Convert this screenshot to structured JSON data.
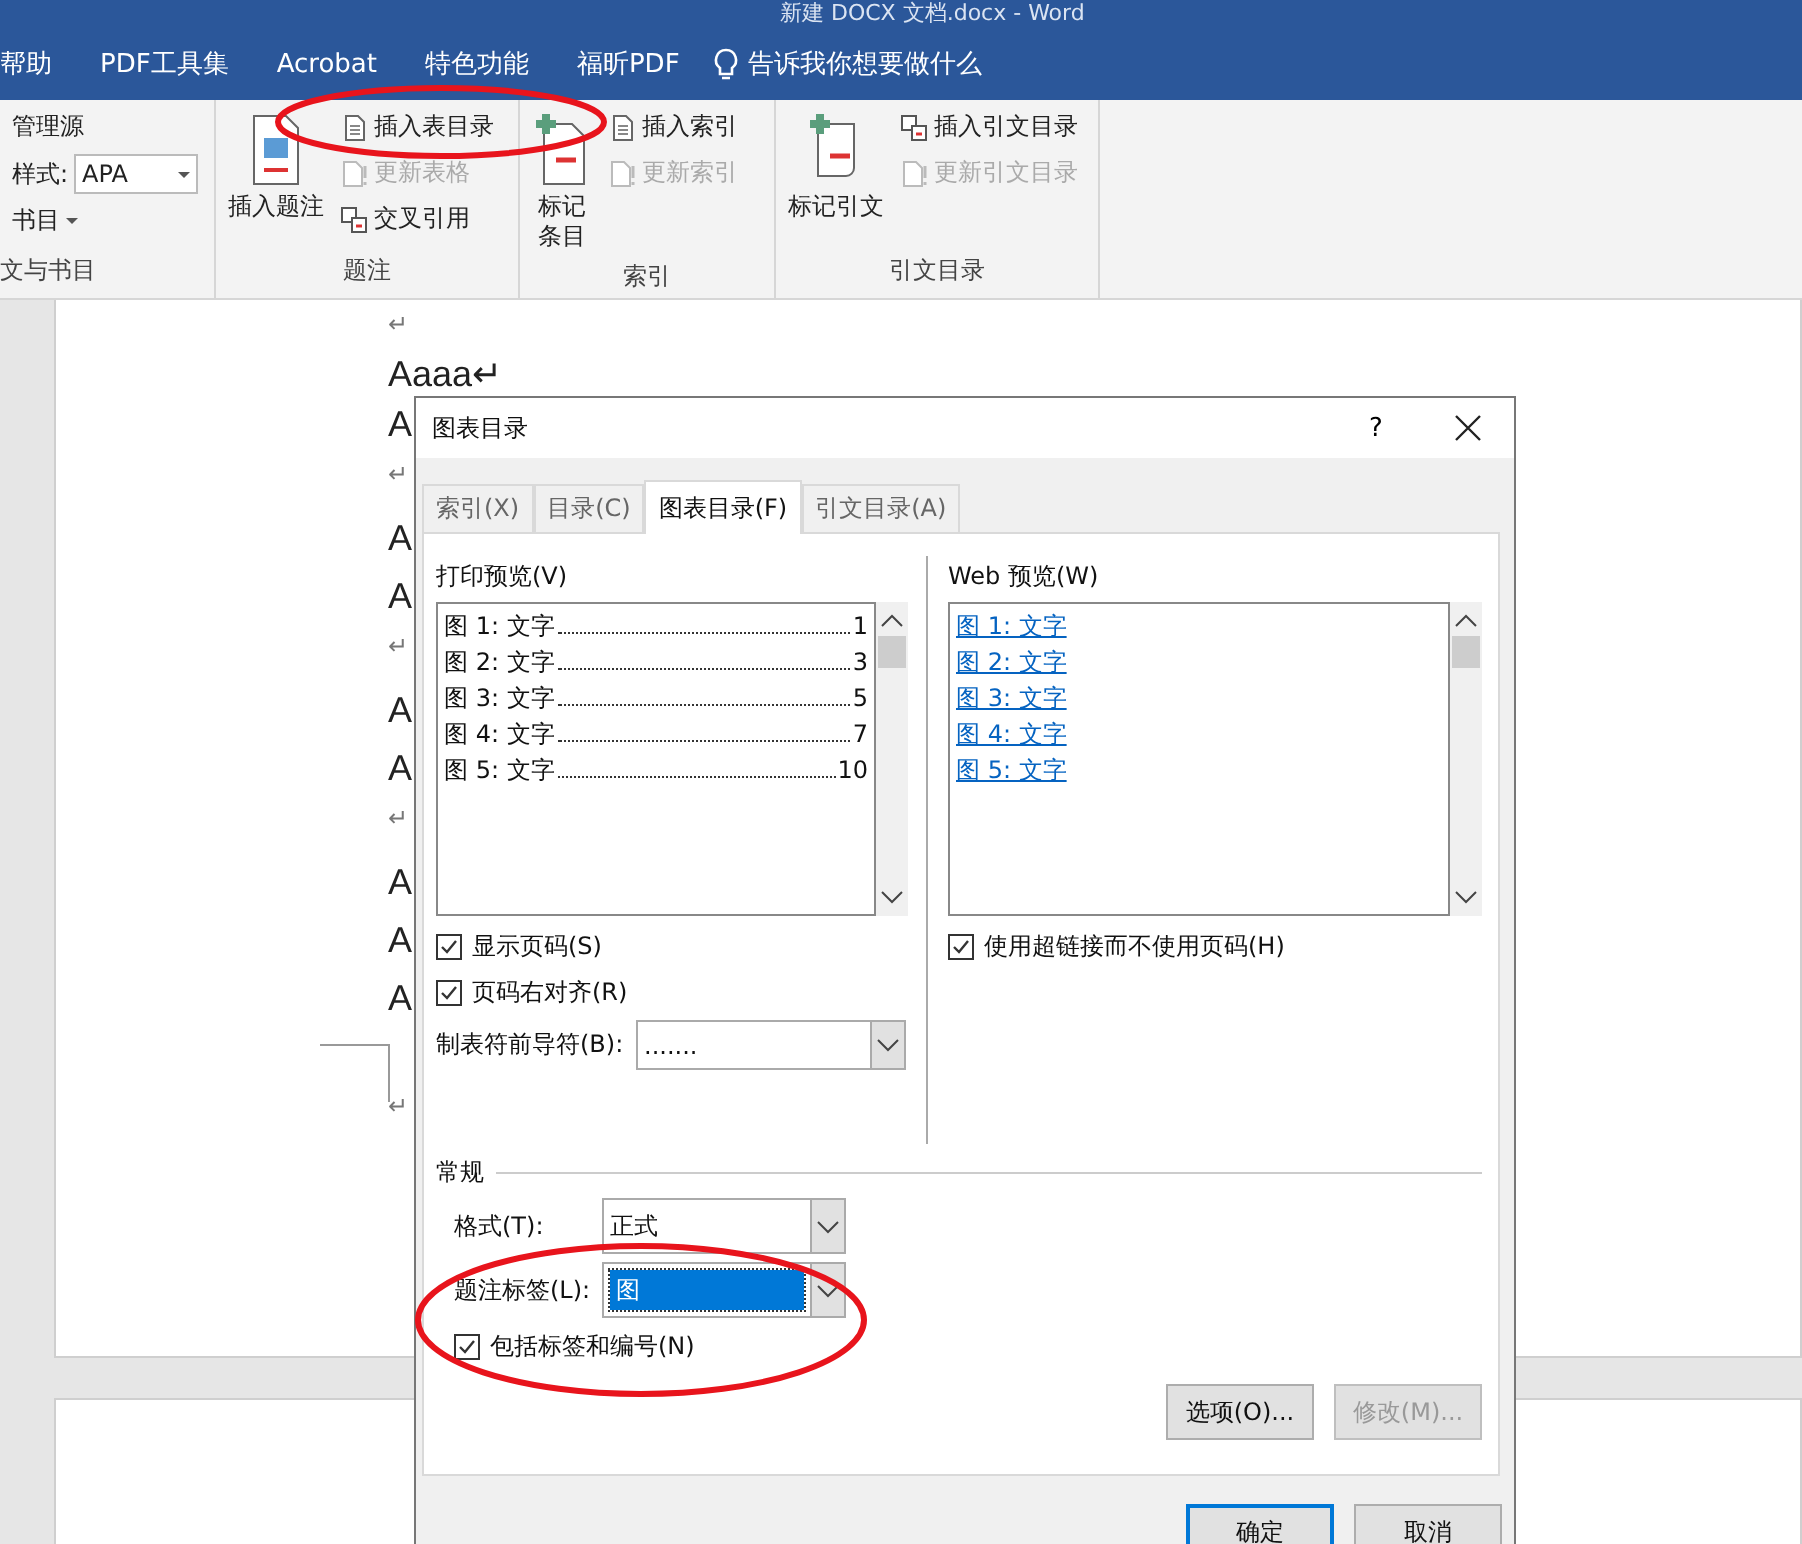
{
  "window": {
    "title": "新建 DOCX 文档.docx - Word"
  },
  "menu": [
    {
      "label": "帮助"
    },
    {
      "label": "PDF工具集"
    },
    {
      "label": "Acrobat"
    },
    {
      "label": "特色功能"
    },
    {
      "label": "福昕PDF"
    }
  ],
  "tell_me": "告诉我你想要做什么",
  "ribbon": {
    "groups": [
      {
        "label": "文与书目",
        "small": [
          {
            "kind": "button",
            "label": "管理源",
            "disabled": false
          },
          {
            "kind": "combo",
            "label": "样式:",
            "value": "APA"
          },
          {
            "kind": "dropdown",
            "label": "书目",
            "disabled": false
          }
        ]
      },
      {
        "label": "题注",
        "large": [
          {
            "label": "插入题注",
            "narrow": false
          }
        ],
        "small": [
          {
            "kind": "button",
            "label": "插入表目录",
            "disabled": false
          },
          {
            "kind": "button",
            "label": "更新表格",
            "disabled": true
          },
          {
            "kind": "button",
            "label": "交叉引用",
            "disabled": false
          }
        ]
      },
      {
        "label": "索引",
        "large": [
          {
            "label": "标记条目",
            "narrow": true
          }
        ],
        "small": [
          {
            "kind": "button",
            "label": "插入索引",
            "disabled": false
          },
          {
            "kind": "button",
            "label": "更新索引",
            "disabled": true
          }
        ]
      },
      {
        "label": "引文目录",
        "large": [
          {
            "label": "标记引文",
            "narrow": false
          }
        ],
        "small": [
          {
            "kind": "button",
            "label": "插入引文目录",
            "disabled": false
          },
          {
            "kind": "button",
            "label": "更新引文目录",
            "disabled": true
          }
        ]
      }
    ]
  },
  "document": {
    "lines": [
      "↵",
      "Aaaa↵",
      "A",
      "↵",
      "A",
      "A",
      "↵",
      "A",
      "A",
      "↵",
      "A",
      "A",
      "A"
    ],
    "after_break": "↵"
  },
  "dialog": {
    "title": "图表目录",
    "help": "?",
    "tabs": [
      {
        "label": "索引(X)",
        "selected": false
      },
      {
        "label": "目录(C)",
        "selected": false
      },
      {
        "label": "图表目录(F)",
        "selected": true
      },
      {
        "label": "引文目录(A)",
        "selected": false
      }
    ],
    "print_preview": {
      "label": "打印预览(V)",
      "entries": [
        {
          "text": "图 1: 文字",
          "page": "1"
        },
        {
          "text": "图 2: 文字",
          "page": "3"
        },
        {
          "text": "图 3: 文字",
          "page": "5"
        },
        {
          "text": "图 4: 文字",
          "page": "7"
        },
        {
          "text": "图 5: 文字",
          "page": "10"
        }
      ]
    },
    "show_page_numbers": {
      "label": "显示页码(S)",
      "checked": true
    },
    "right_align": {
      "label": "页码右对齐(R)",
      "checked": true
    },
    "tab_leader": {
      "label": "制表符前导符(B):",
      "value": "......."
    },
    "web_preview": {
      "label": "Web 预览(W)",
      "links": [
        "图 1: 文字",
        "图 2: 文字",
        "图 3: 文字",
        "图 4: 文字",
        "图 5: 文字"
      ]
    },
    "use_hyperlinks": {
      "label": "使用超链接而不使用页码(H)",
      "checked": true
    },
    "general": {
      "label": "常规",
      "format": {
        "label": "格式(T):",
        "value": "正式"
      },
      "caption_label": {
        "label": "题注标签(L):",
        "value": "图",
        "selected": true
      },
      "include_label": {
        "label": "包括标签和编号(N)",
        "checked": true
      }
    },
    "buttons": [
      {
        "label": "选项(O)...",
        "disabled": false
      },
      {
        "label": "修改(M)...",
        "disabled": true
      }
    ],
    "footer_buttons": [
      {
        "label": "确定",
        "default": true
      },
      {
        "label": "取消",
        "default": false
      }
    ]
  },
  "annotations": [
    {
      "kind": "ellipse"
    },
    {
      "kind": "ellipse"
    }
  ]
}
